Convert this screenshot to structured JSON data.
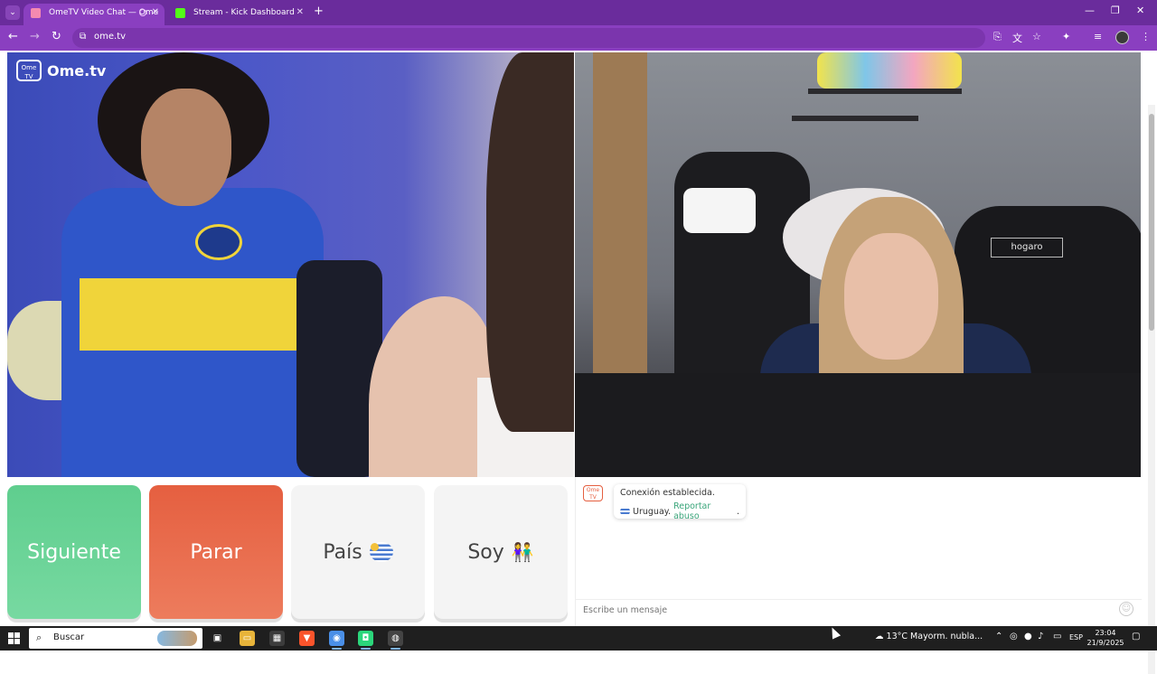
{
  "browser": {
    "tabs": [
      {
        "title": "OmeTV Video Chat — Ome",
        "favicon_color": "#f58ab0",
        "active": true
      },
      {
        "title": "Stream - Kick Dashboard",
        "favicon_color": "#53fc18",
        "active": false
      }
    ],
    "new_tab_icon": "plus-icon",
    "url": "ome.tv",
    "theme_color": "#8a3fc0"
  },
  "site": {
    "logo_badge": "Ome TV",
    "logo_text": "Ome.tv"
  },
  "self_video": {
    "chair_label": "hogaro"
  },
  "controls": {
    "next_label": "Siguiente",
    "stop_label": "Parar",
    "country_label": "País",
    "gender_label": "Soy",
    "next_color": "#5fce8e",
    "stop_color": "#e55f40"
  },
  "chat": {
    "logo_badge": "Ome TV",
    "status_message": "Conexión establecida.",
    "country": "Uruguay.",
    "report_link": "Reportar abuso",
    "report_suffix": ".",
    "input_placeholder": "Escribe un mensaje"
  },
  "taskbar": {
    "search_label": "Buscar",
    "weather_temp": "13°C",
    "weather_text": "Mayorm. nubla...",
    "language": "ESP",
    "time": "23:04",
    "date": "21/9/2025"
  }
}
